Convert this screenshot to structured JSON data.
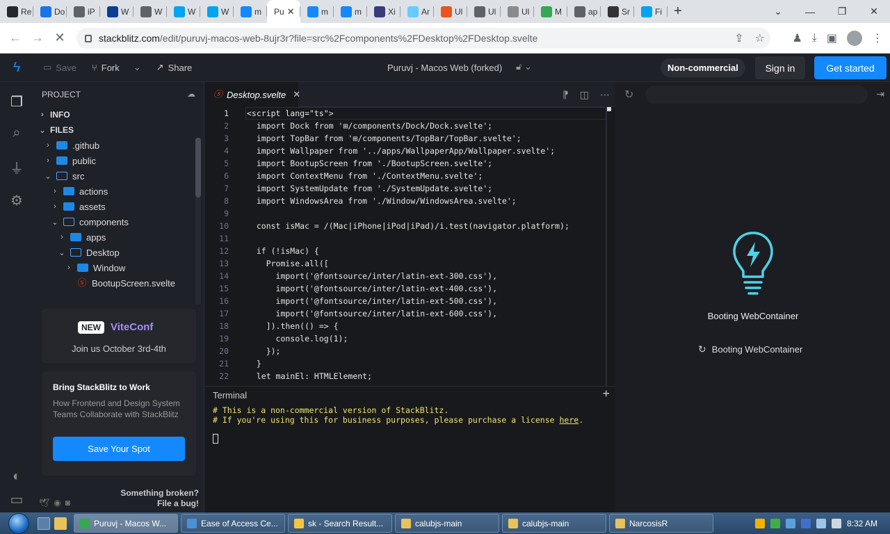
{
  "browser": {
    "tabs": [
      {
        "label": "Re",
        "icon": "github-icon",
        "color": "#24292e"
      },
      {
        "label": "Do",
        "icon": "download-icon",
        "color": "#1a73e8"
      },
      {
        "label": "iP",
        "icon": "web-icon",
        "color": "#5f6368"
      },
      {
        "label": "W",
        "icon": "app-icon",
        "color": "#0b3d91"
      },
      {
        "label": "W",
        "icon": "web-icon",
        "color": "#5f6368"
      },
      {
        "label": "W",
        "icon": "windows-icon",
        "color": "#00a4ef"
      },
      {
        "label": "W",
        "icon": "windows-icon",
        "color": "#00a4ef"
      },
      {
        "label": "m",
        "icon": "edge-icon",
        "color": "#1389fd"
      },
      {
        "label": "Pu",
        "icon": "",
        "color": "#ffffff",
        "active": true
      },
      {
        "label": "m",
        "icon": "edge-icon",
        "color": "#1389fd"
      },
      {
        "label": "m",
        "icon": "edge-icon",
        "color": "#1389fd"
      },
      {
        "label": "Xi",
        "icon": "app-icon",
        "color": "#3b3b7a"
      },
      {
        "label": "Ar",
        "icon": "snow-icon",
        "color": "#66ccff"
      },
      {
        "label": "Ul",
        "icon": "ubuntu-icon",
        "color": "#e95420"
      },
      {
        "label": "Ul",
        "icon": "web-icon",
        "color": "#5f6368"
      },
      {
        "label": "Ul",
        "icon": "web-icon",
        "color": "#8a8a8a"
      },
      {
        "label": "M",
        "icon": "chrome-icon",
        "color": "#34a853"
      },
      {
        "label": "ap",
        "icon": "web-icon",
        "color": "#5f6368"
      },
      {
        "label": "Sr",
        "icon": "app-icon",
        "color": "#333333"
      },
      {
        "label": "Fi",
        "icon": "windows-icon",
        "color": "#00a4ef"
      }
    ],
    "url_host": "stackblitz.com",
    "url_path": "/edit/puruvj-macos-web-8ujr3r?file=src%2Fcomponents%2FDesktop%2FDesktop.svelte"
  },
  "header": {
    "save": "Save",
    "fork": "Fork",
    "share": "Share",
    "title": "Puruvj - Macos Web (forked)",
    "non_commercial": "Non-commercial",
    "sign_in": "Sign in",
    "get_started": "Get started",
    "accent": "#1389fd"
  },
  "sidebar": {
    "project_label": "PROJECT",
    "info": "INFO",
    "files": "FILES",
    "tree": [
      {
        "label": ".github",
        "depth": 1,
        "open": false,
        "type": "folder"
      },
      {
        "label": "public",
        "depth": 1,
        "open": false,
        "type": "folder"
      },
      {
        "label": "src",
        "depth": 1,
        "open": true,
        "type": "folder"
      },
      {
        "label": "actions",
        "depth": 2,
        "open": false,
        "type": "folder"
      },
      {
        "label": "assets",
        "depth": 2,
        "open": false,
        "type": "folder"
      },
      {
        "label": "components",
        "depth": 2,
        "open": true,
        "type": "folder"
      },
      {
        "label": "apps",
        "depth": 3,
        "open": false,
        "type": "folder"
      },
      {
        "label": "Desktop",
        "depth": 3,
        "open": true,
        "type": "folder"
      },
      {
        "label": "Window",
        "depth": 4,
        "open": false,
        "type": "folder"
      },
      {
        "label": "BootupScreen.svelte",
        "depth": 4,
        "open": false,
        "type": "svelte"
      }
    ],
    "promo_badge": "NEW",
    "promo_brand": "ViteConf",
    "promo_date": "Join us October 3rd-4th",
    "work_title": "Bring StackBlitz to Work",
    "work_desc": "How Frontend and Design System Teams Collaborate with StackBlitz",
    "work_button": "Save Your Spot",
    "broken_line1": "Something broken?",
    "broken_line2": "File a bug!"
  },
  "editor": {
    "tab": "Desktop.svelte",
    "lines": [
      "<script lang=\"ts\">",
      "  import Dock from '⊞/components/Dock/Dock.svelte';",
      "  import TopBar from '⊞/components/TopBar/TopBar.svelte';",
      "  import Wallpaper from '../apps/WallpaperApp/Wallpaper.svelte';",
      "  import BootupScreen from './BootupScreen.svelte';",
      "  import ContextMenu from './ContextMenu.svelte';",
      "  import SystemUpdate from './SystemUpdate.svelte';",
      "  import WindowsArea from './Window/WindowsArea.svelte';",
      "",
      "  const isMac = /(Mac|iPhone|iPod|iPad)/i.test(navigator.platform);",
      "",
      "  if (!isMac) {",
      "    Promise.all([",
      "      import('@fontsource/inter/latin-ext-300.css'),",
      "      import('@fontsource/inter/latin-ext-400.css'),",
      "      import('@fontsource/inter/latin-ext-500.css'),",
      "      import('@fontsource/inter/latin-ext-600.css'),",
      "    ]).then(() => {",
      "      console.log(1);",
      "    });",
      "  }",
      "  let mainEl: HTMLElement;"
    ]
  },
  "terminal": {
    "title": "Terminal",
    "line1": "# This is a non-commercial version of StackBlitz.",
    "line2_pre": "# If you're using this for business purposes, please purchase a license ",
    "line2_link": "here",
    "line2_post": "."
  },
  "preview": {
    "status1": "Booting WebContainer",
    "status2": "Booting WebContainer",
    "bulb_color": "#4fd1e8"
  },
  "taskbar": {
    "items": [
      {
        "label": "Puruvj - Macos W...",
        "color": "#34a853",
        "active": true
      },
      {
        "label": "Ease of Access Ce...",
        "color": "#4a90d9"
      },
      {
        "label": "sk - Search Result...",
        "color": "#f5c542"
      },
      {
        "label": "calubjs-main",
        "color": "#e8c25a"
      },
      {
        "label": "calubjs-main",
        "color": "#e8c25a"
      },
      {
        "label": "NarcosisR",
        "color": "#e8c25a"
      }
    ],
    "clock": "8:32 AM"
  }
}
